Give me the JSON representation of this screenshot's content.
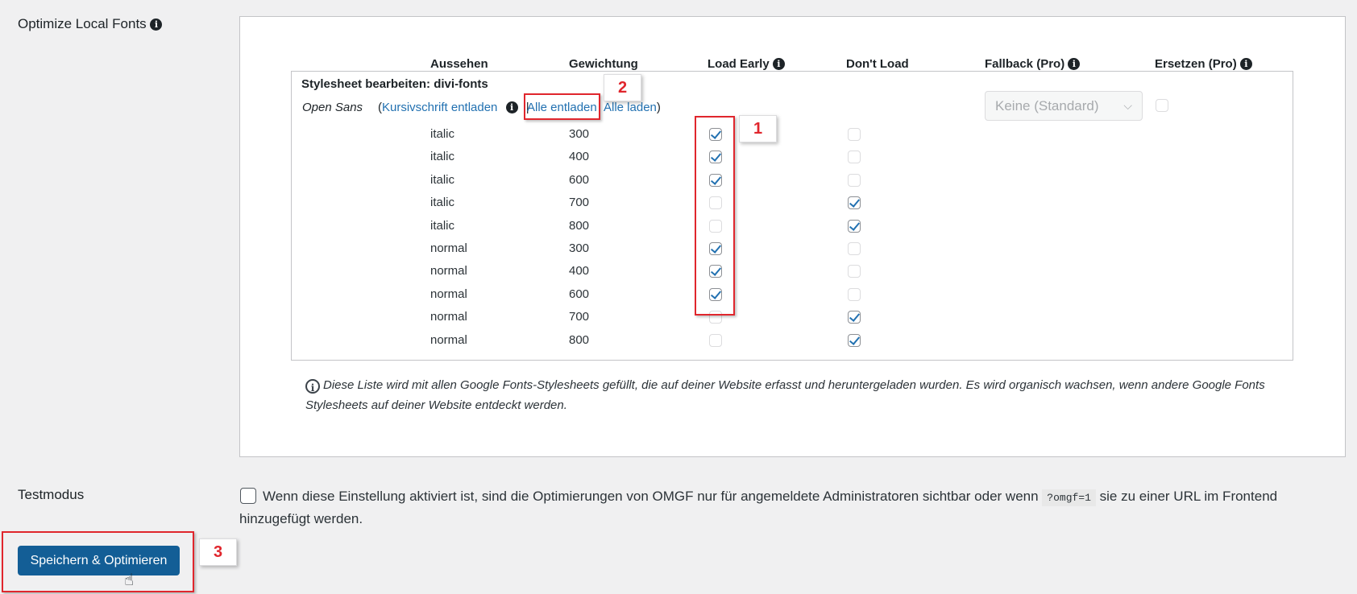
{
  "section": {
    "title": "Optimize Local Fonts",
    "info_icon": "info-icon"
  },
  "table": {
    "headers": {
      "appearance": "Aussehen",
      "weight": "Gewichtung",
      "load_early": "Load Early",
      "dont_load": "Don't Load",
      "fallback": "Fallback (Pro)",
      "replace": "Ersetzen (Pro)"
    },
    "stylesheet_title": "Stylesheet bearbeiten: divi-fonts",
    "font_name": "Open Sans",
    "links": {
      "open_paren": "(",
      "unload_italic": "Kursivschrift entladen",
      "separator": "|",
      "unload_all": "Alle entladen",
      "load_all": "Alle laden",
      "close_paren": ")"
    },
    "fallback_select": {
      "value": "Keine (Standard)"
    },
    "rows": [
      {
        "style": "italic",
        "weight": "300",
        "load_early": true,
        "dont_load": false
      },
      {
        "style": "italic",
        "weight": "400",
        "load_early": true,
        "dont_load": false
      },
      {
        "style": "italic",
        "weight": "600",
        "load_early": true,
        "dont_load": false
      },
      {
        "style": "italic",
        "weight": "700",
        "load_early": false,
        "dont_load": true
      },
      {
        "style": "italic",
        "weight": "800",
        "load_early": false,
        "dont_load": true
      },
      {
        "style": "normal",
        "weight": "300",
        "load_early": true,
        "dont_load": false
      },
      {
        "style": "normal",
        "weight": "400",
        "load_early": true,
        "dont_load": false
      },
      {
        "style": "normal",
        "weight": "600",
        "load_early": true,
        "dont_load": false
      },
      {
        "style": "normal",
        "weight": "700",
        "load_early": false,
        "dont_load": true
      },
      {
        "style": "normal",
        "weight": "800",
        "load_early": false,
        "dont_load": true
      }
    ],
    "note": "Diese Liste wird mit allen Google Fonts-Stylesheets gefüllt, die auf deiner Website erfasst und heruntergeladen wurden. Es wird organisch wachsen, wenn andere Google Fonts Stylesheets auf deiner Website entdeckt werden."
  },
  "testmode": {
    "title": "Testmodus",
    "text_before": "Wenn diese Einstellung aktiviert ist, sind die Optimierungen von OMGF nur für angemeldete Administratoren sichtbar oder wenn",
    "code": "?omgf=1",
    "text_after": "sie zu einer URL im Frontend hinzugefügt werden.",
    "checked": false
  },
  "save_button": "Speichern & Optimieren",
  "callouts": [
    "1",
    "2",
    "3"
  ],
  "colors": {
    "accent": "#2271b1",
    "primary_button": "#135e96",
    "annotation_red": "#e0262d",
    "background": "#f0f0f1"
  }
}
